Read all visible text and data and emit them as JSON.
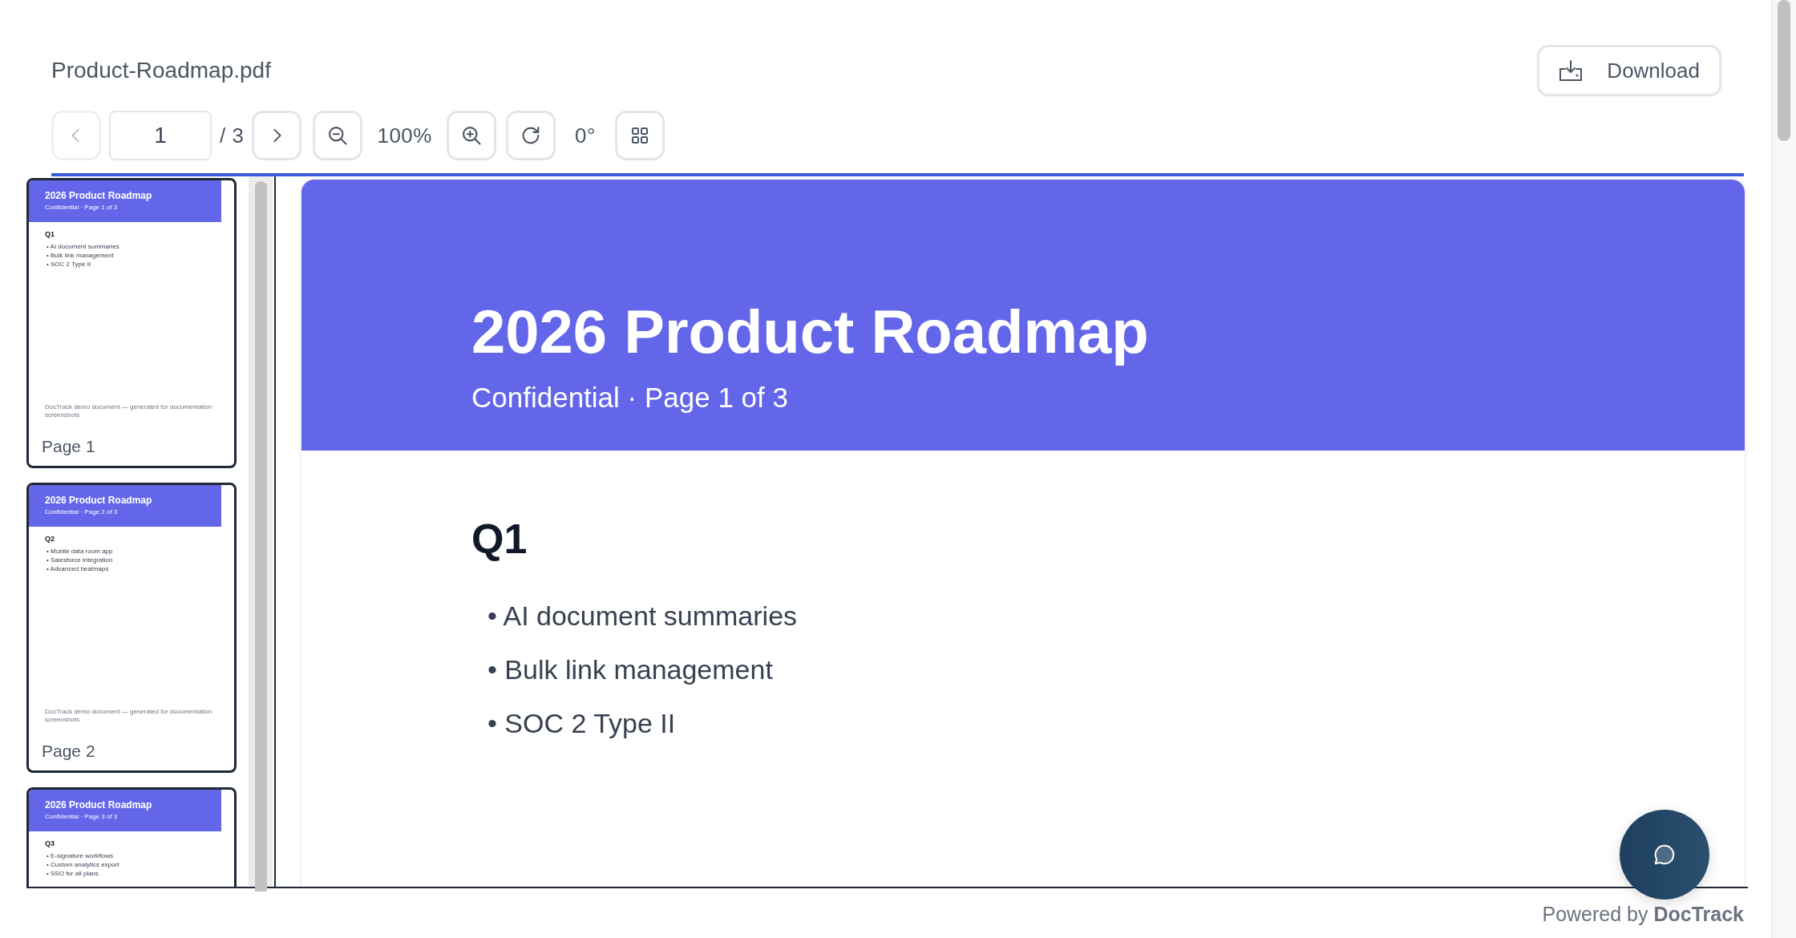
{
  "document": {
    "file_name": "Product-Roadmap.pdf"
  },
  "download_button": {
    "label": "Download"
  },
  "toolbar": {
    "prev_disabled": true,
    "page_input": {
      "value": "1"
    },
    "page_total": "/ 3",
    "zoom": "100%",
    "rotation": "0°"
  },
  "thumbnails": [
    {
      "title": "2026 Product Roadmap",
      "subtitle": "Confidential · Page 1 of 3",
      "heading": "Q1",
      "bullets": [
        "• AI document summaries",
        "• Bulk link management",
        "• SOC 2 Type II"
      ],
      "footer": "DocTrack demo document — generated for documentation screenshots",
      "label": "Page 1"
    },
    {
      "title": "2026 Product Roadmap",
      "subtitle": "Confidential · Page 2 of 3",
      "heading": "Q2",
      "bullets": [
        "• Mobile data room app",
        "• Salesforce integration",
        "• Advanced heatmaps"
      ],
      "footer": "DocTrack demo document — generated for documentation screenshots",
      "label": "Page 2"
    },
    {
      "title": "2026 Product Roadmap",
      "subtitle": "Confidential · Page 3 of 3",
      "heading": "Q3",
      "bullets": [
        "• E-signature workflows",
        "• Custom analytics export",
        "• SSO for all plans"
      ]
    }
  ],
  "page": {
    "title": "2026 Product Roadmap",
    "subtitle": "Confidential · Page 1 of 3",
    "heading": "Q1",
    "bullets": [
      "• AI document summaries",
      "• Bulk link management",
      "• SOC 2 Type II"
    ]
  },
  "footer": {
    "text": "Powered by **DocTrack**"
  }
}
